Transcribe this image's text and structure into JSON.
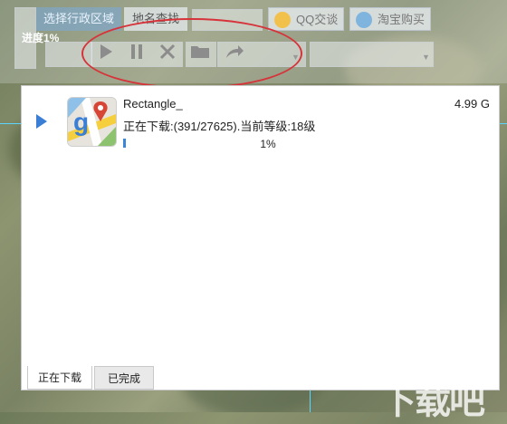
{
  "toolbar": {
    "tab_select_region": "选择行政区域",
    "tab_place_search": "地名查找",
    "qq_chat": "QQ交谈",
    "taobao_buy": "淘宝购买",
    "progress_label": "进度1%"
  },
  "task": {
    "name": "Rectangle_",
    "size": "4.99 G",
    "status": "正在下载:(391/27625).当前等级:18级",
    "progress_text": "1%",
    "progress_fraction": 0.01
  },
  "tabs": {
    "downloading": "正在下载",
    "completed": "已完成"
  },
  "watermark": "下载吧",
  "colors": {
    "accent": "#3a7fd5",
    "highlight_oval": "#d6333a"
  }
}
